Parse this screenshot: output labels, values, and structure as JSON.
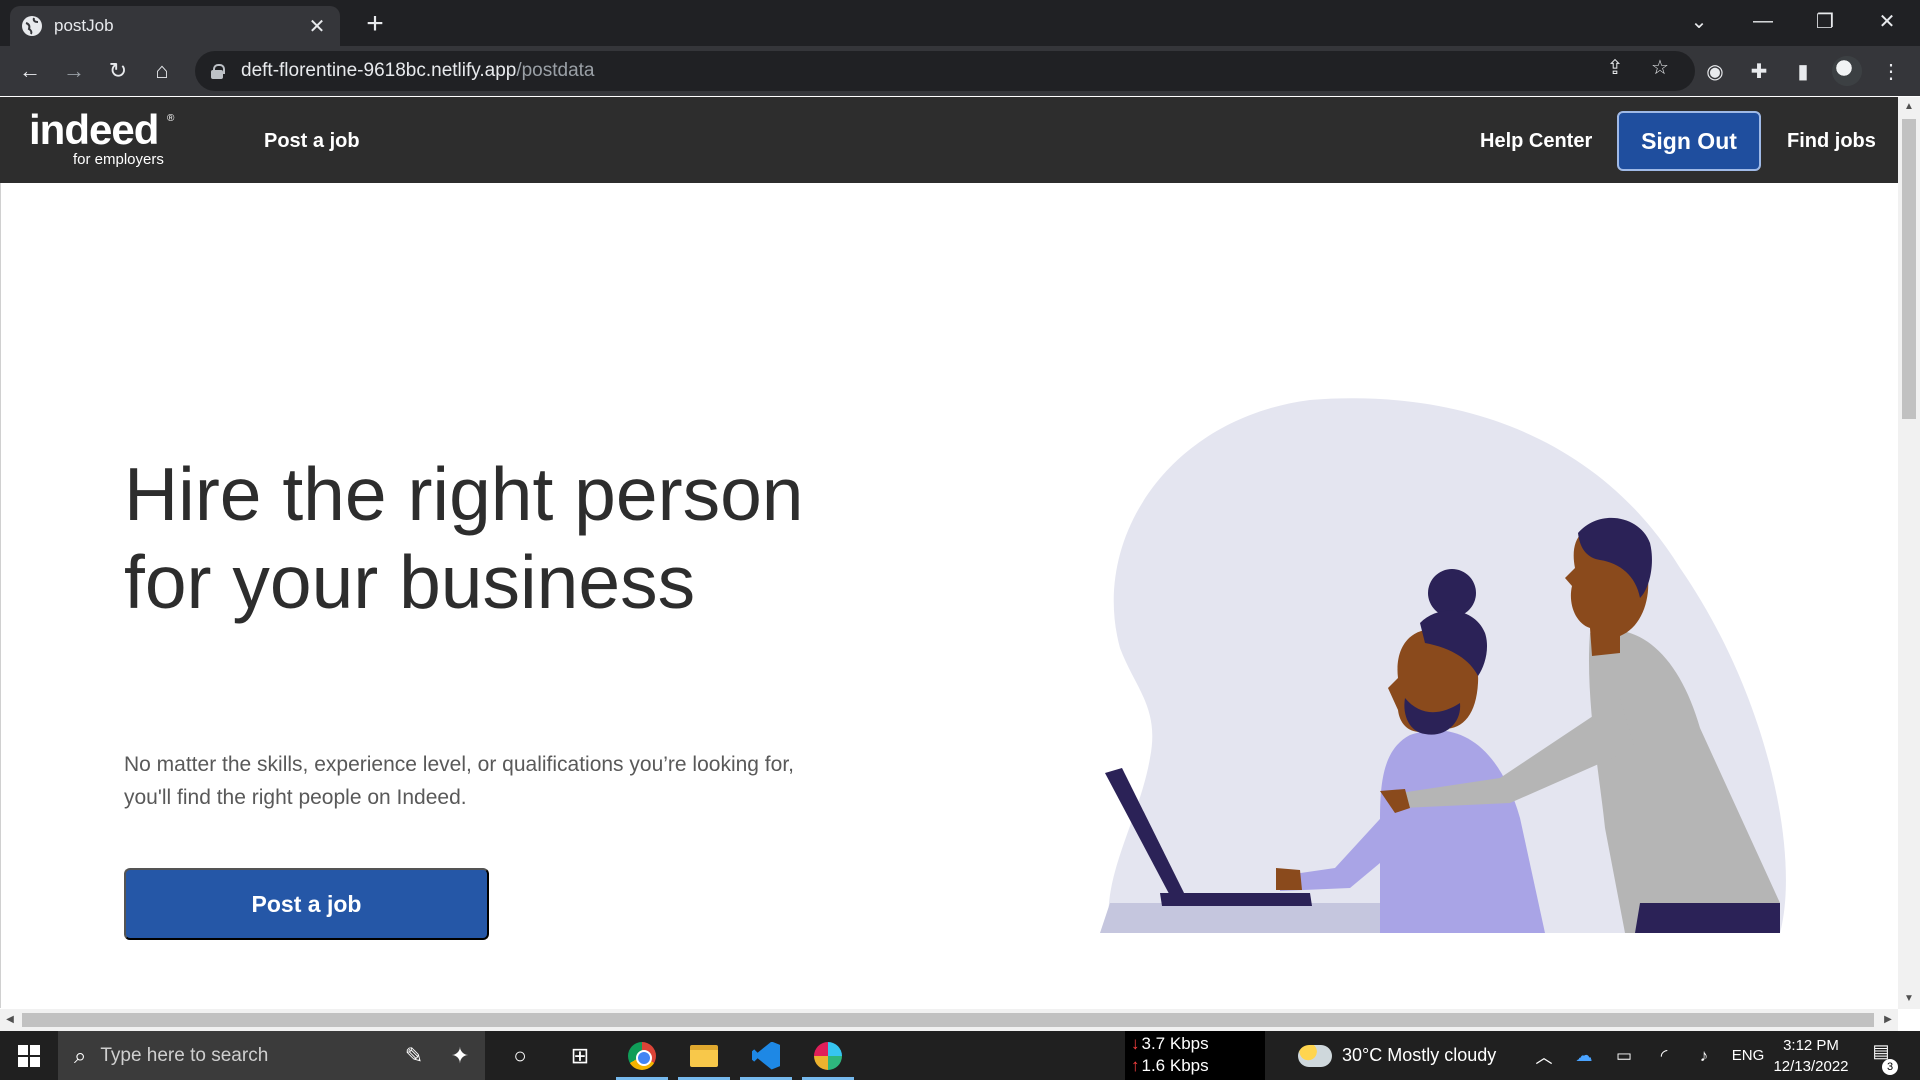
{
  "browser": {
    "tab_title": "postJob",
    "new_tab": "+",
    "url_host": "deft-florentine-9618bc.netlify.app",
    "url_path": "/postdata"
  },
  "site": {
    "logo_text": "indeed",
    "logo_sub": "for employers",
    "nav": {
      "post_job": "Post a job",
      "help_center": "Help Center",
      "sign_out": "Sign Out",
      "find_jobs": "Find jobs"
    },
    "hero": {
      "title_line1": "Hire the right person",
      "title_line2": "for your business",
      "subtitle_line1": "No matter the skills, experience level, or qualifications you’re looking for,",
      "subtitle_line2": "you'll find the right people on Indeed.",
      "cta": "Post a job"
    },
    "colors": {
      "navbar_bg": "#2d2d2d",
      "brand_blue": "#2557a7",
      "signout_bg": "#1f4e9e"
    }
  },
  "taskbar": {
    "search_placeholder": "Type here to search",
    "net_down": "3.7 Kbps",
    "net_up": "1.6 Kbps",
    "weather": "30°C  Mostly cloudy",
    "language": "ENG",
    "time": "3:12 PM",
    "date": "12/13/2022",
    "notification_count": "3"
  }
}
